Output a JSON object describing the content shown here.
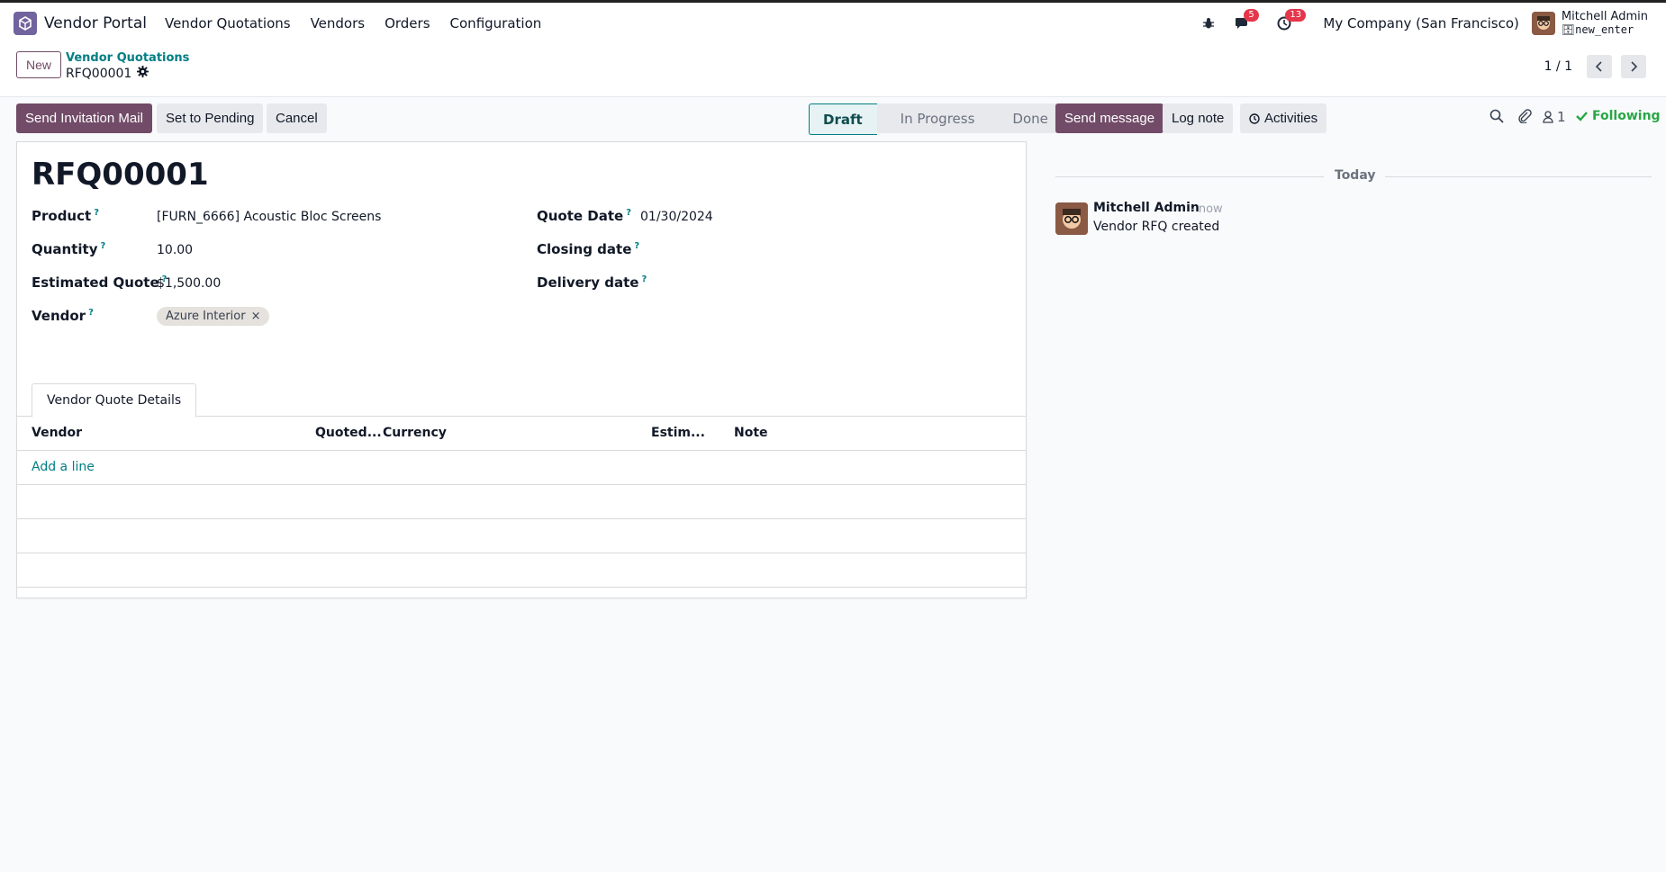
{
  "navbar": {
    "app_name": "Vendor Portal",
    "menu": [
      "Vendor Quotations",
      "Vendors",
      "Orders",
      "Configuration"
    ],
    "messages_badge": "5",
    "activities_badge": "13",
    "company": "My Company (San Francisco)",
    "user_name": "Mitchell Admin",
    "db_name": "new_enter"
  },
  "control_panel": {
    "new_label": "New",
    "breadcrumb_parent": "Vendor Quotations",
    "breadcrumb_current": "RFQ00001",
    "pager_value": "1 / 1"
  },
  "statusbar": {
    "buttons": [
      "Send Invitation Mail",
      "Set to Pending",
      "Cancel"
    ],
    "stages": [
      "Draft",
      "In Progress",
      "Done"
    ],
    "active_stage": "Draft"
  },
  "form": {
    "title": "RFQ00001",
    "product_label": "Product",
    "product_value": "[FURN_6666] Acoustic Bloc Screens",
    "quantity_label": "Quantity",
    "quantity_value": "10.00",
    "estimated_label": "Estimated Quote",
    "estimated_value": "$1,500.00",
    "vendor_label": "Vendor",
    "vendor_tag": "Azure Interior",
    "quote_date_label": "Quote Date",
    "quote_date_value": "01/30/2024",
    "closing_date_label": "Closing date",
    "delivery_date_label": "Delivery date",
    "help_mark": "?"
  },
  "tab": {
    "label": "Vendor Quote Details"
  },
  "table": {
    "columns": [
      "Vendor",
      "Quoted...",
      "Currency",
      "Estim...",
      "Note"
    ],
    "add_line": "Add a line"
  },
  "chatter": {
    "send_message": "Send message",
    "log_note": "Log note",
    "activities": "Activities",
    "followers_count": "1",
    "following": "Following",
    "date_separator": "Today",
    "message": {
      "author": "Mitchell Admin",
      "time": "- now",
      "body": "Vendor RFQ created"
    }
  }
}
